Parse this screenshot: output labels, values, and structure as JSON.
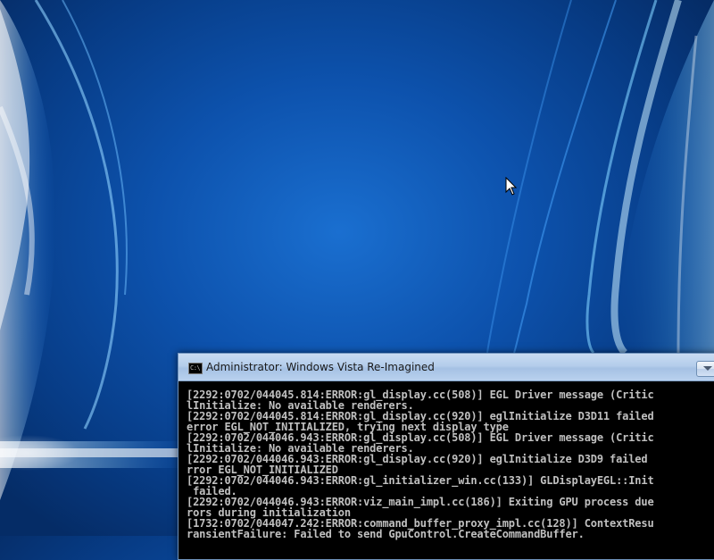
{
  "wallpaper": {
    "name": "Windows Vista aurora wallpaper"
  },
  "console": {
    "title": "Administrator:  Windows Vista Re-Imagined",
    "app_icon_text": "C:\\",
    "lines": [
      "[2292:0702/044045.814:ERROR:gl_display.cc(508)] EGL Driver message (Critic",
      "lInitialize: No available renderers.",
      "[2292:0702/044045.814:ERROR:gl_display.cc(920)] eglInitialize D3D11 failed",
      "error EGL_NOT_INITIALIZED, trying next display type",
      "[2292:0702/044046.943:ERROR:gl_display.cc(508)] EGL Driver message (Critic",
      "lInitialize: No available renderers.",
      "[2292:0702/044046.943:ERROR:gl_display.cc(920)] eglInitialize D3D9 failed",
      "rror EGL_NOT_INITIALIZED",
      "[2292:0702/044046.943:ERROR:gl_initializer_win.cc(133)] GLDisplayEGL::Init",
      " failed.",
      "[2292:0702/044046.943:ERROR:viz_main_impl.cc(186)] Exiting GPU process due",
      "rors during initialization",
      "[1732:0702/044047.242:ERROR:command_buffer_proxy_impl.cc(128)] ContextResu",
      "ransientFailure: Failed to send GpuControl.CreateCommandBuffer."
    ]
  }
}
